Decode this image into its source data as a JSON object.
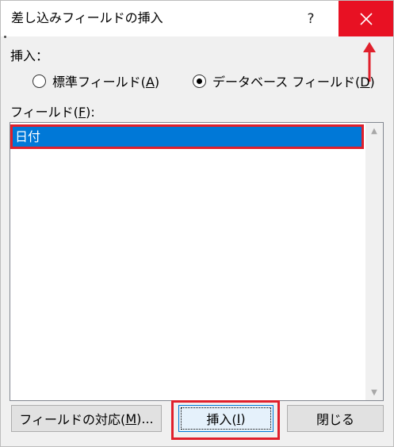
{
  "dialog": {
    "title": "差し込みフィールドの挿入",
    "help_label": "?",
    "close_icon": "close-icon",
    "accent_close": "#e81123",
    "annotation_color": "#e0202c"
  },
  "insert": {
    "label": "挿入："
  },
  "radios": [
    {
      "label_pre": "標準フィールド(",
      "access": "A",
      "label_post": ")",
      "checked": false
    },
    {
      "label_pre": "データベース フィールド(",
      "access": "D",
      "label_post": ")",
      "checked": true
    }
  ],
  "fields": {
    "label_pre": "フィールド(",
    "access": "F",
    "label_post": "):",
    "items": [
      "日付"
    ],
    "selected_index": 0
  },
  "buttons": {
    "map_pre": "フィールドの対応(",
    "map_access": "M",
    "map_post": ")...",
    "insert_pre": "挿入(",
    "insert_access": "I",
    "insert_post": ")",
    "close": "閉じる"
  }
}
